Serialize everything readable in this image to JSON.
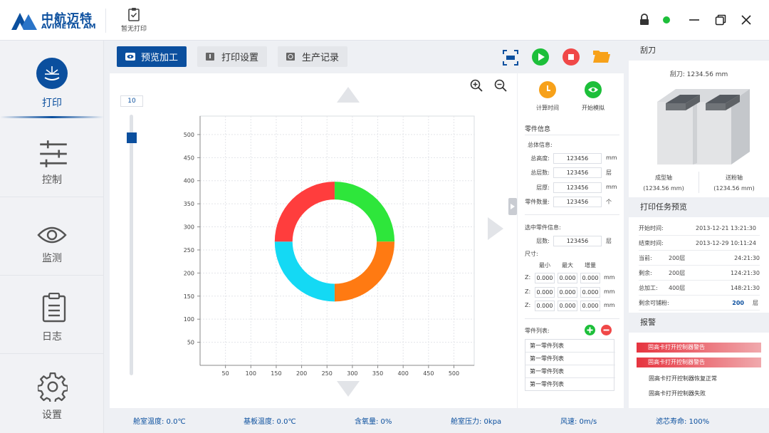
{
  "app": {
    "logo_cn": "中航迈特",
    "logo_en": "AVIMETAL AM",
    "no_print": "暂无打印"
  },
  "sidebar": {
    "items": [
      {
        "label": "打印",
        "active": true
      },
      {
        "label": "控制"
      },
      {
        "label": "监测"
      },
      {
        "label": "日志"
      },
      {
        "label": "设置"
      }
    ]
  },
  "toolbar": {
    "tabs": [
      {
        "label": "预览加工",
        "active": true
      },
      {
        "label": "打印设置"
      },
      {
        "label": "生产记录"
      }
    ]
  },
  "layer_slider": {
    "value": "10"
  },
  "chart_data": {
    "type": "pie",
    "xlim": [
      0,
      540
    ],
    "ylim": [
      0,
      540
    ],
    "xticks": [
      "50",
      "100",
      "150",
      "200",
      "250",
      "300",
      "350",
      "400",
      "450",
      "500"
    ],
    "yticks": [
      "50",
      "100",
      "150",
      "200",
      "250",
      "300",
      "350",
      "400",
      "450",
      "500"
    ],
    "grid": true,
    "donut": {
      "center_x": 265,
      "center_y": 268,
      "outer_r": 118,
      "inner_r": 83
    },
    "slices": [
      {
        "color": "#2ee63b",
        "value": 25
      },
      {
        "color": "#ff7a12",
        "value": 25
      },
      {
        "color": "#14d9f4",
        "value": 25
      },
      {
        "color": "#ff3d3d",
        "value": 25
      }
    ]
  },
  "actions": {
    "calc_time": "计算时间",
    "start_sim": "开始模拟"
  },
  "part_info": {
    "title": "零件信息",
    "overall": "总体信息:",
    "total_height": {
      "label": "总高度:",
      "value": "123456",
      "unit": "mm"
    },
    "total_layers": {
      "label": "总层数:",
      "value": "123456",
      "unit": "层"
    },
    "layer_thick": {
      "label": "层厚:",
      "value": "123456",
      "unit": "mm"
    },
    "part_count": {
      "label": "零件数量:",
      "value": "123456",
      "unit": "个"
    },
    "selected": "选中零件信息:",
    "sel_layers": {
      "label": "层数:",
      "value": "123456",
      "unit": "层"
    },
    "size_label": "尺寸:",
    "size_cols": [
      "最小",
      "最大",
      "增量"
    ],
    "size_rows": [
      {
        "axis": "Z:",
        "values": [
          "0.000",
          "0.000",
          "0.000"
        ],
        "unit": "mm"
      },
      {
        "axis": "Z:",
        "values": [
          "0.000",
          "0.000",
          "0.000"
        ],
        "unit": "mm"
      },
      {
        "axis": "Z:",
        "values": [
          "0.000",
          "0.000",
          "0.000"
        ],
        "unit": "mm"
      }
    ],
    "list_title": "零件列表:",
    "list": [
      "第一零件列表",
      "第一零件列表",
      "第一零件列表",
      "第一零件列表"
    ]
  },
  "blade": {
    "title": "刮刀",
    "value_line": "刮刀:   1234.56  mm",
    "form_axis": {
      "label": "成型轴",
      "value": "(1234.56  mm)"
    },
    "powder_axis": {
      "label": "送粉轴",
      "value": "(1234.56  mm)"
    }
  },
  "task": {
    "title": "打印任务预览",
    "rows": [
      {
        "label": "开始时间:",
        "mid": "",
        "value": "2013-12-21  13:21:30"
      },
      {
        "label": "结束时间:",
        "mid": "",
        "value": "2013-12-29  10:11:24"
      },
      {
        "label": "当前:",
        "mid": "200层",
        "value": "24:21:30"
      },
      {
        "label": "剩余:",
        "mid": "200层",
        "value": "124:21:30"
      },
      {
        "label": "总加工:",
        "mid": "400层",
        "value": "148:21:30"
      },
      {
        "label": "剩余可铺粉:",
        "mid": "",
        "value": "200",
        "unit": "层"
      }
    ]
  },
  "alarm": {
    "title": "报警",
    "items": [
      {
        "text": "固高卡打开控制器警告",
        "level": "error"
      },
      {
        "text": "固高卡打开控制器警告",
        "level": "error"
      },
      {
        "text": "固高卡打开控制器恢复正常",
        "level": "info"
      },
      {
        "text": "固高卡打开控制器失败",
        "level": "info"
      }
    ]
  },
  "status": {
    "chamber_temp": "舱室温度: 0.0℃",
    "base_temp": "基板温度: 0.0℃",
    "oxygen": "含氧量: 0%",
    "chamber_pressure": "舱室压力: 0kpa",
    "wind": "风速: 0m/s",
    "filter_life": "滤芯寿命: 100%"
  }
}
